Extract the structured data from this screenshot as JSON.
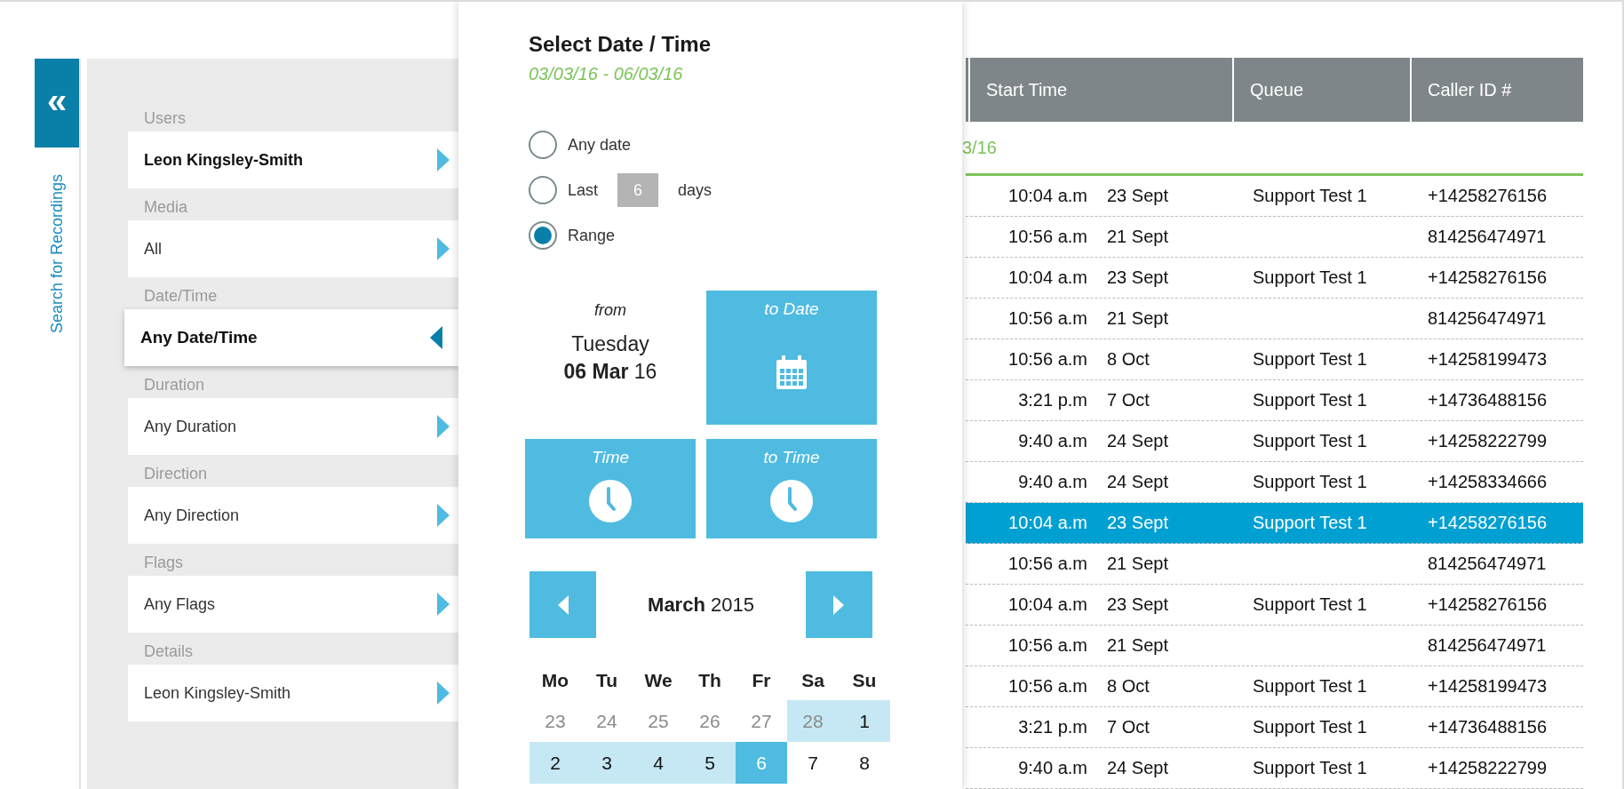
{
  "sidebar": {
    "collapse_button": "«",
    "title": "Search for Recordings",
    "filters": [
      {
        "label": "Users",
        "value": "Leon Kingsley-Smith",
        "bold": true,
        "selected": false
      },
      {
        "label": "Media",
        "value": "All",
        "bold": false,
        "selected": false
      },
      {
        "label": "Date/Time",
        "value": "Any Date/Time",
        "bold": true,
        "selected": true
      },
      {
        "label": "Duration",
        "value": "Any Duration",
        "bold": false,
        "selected": false
      },
      {
        "label": "Direction",
        "value": "Any Direction",
        "bold": false,
        "selected": false
      },
      {
        "label": "Flags",
        "value": "Any Flags",
        "bold": false,
        "selected": false
      },
      {
        "label": "Details",
        "value": "Leon Kingsley-Smith",
        "bold": false,
        "selected": false
      }
    ]
  },
  "date_picker": {
    "title": "Select Date / Time",
    "range": "03/03/16 - 06/03/16",
    "options": [
      {
        "kind": "plain",
        "label": "Any date",
        "selected": false
      },
      {
        "kind": "days",
        "label": "Last",
        "placeholder": "6",
        "suffix": "days",
        "selected": false
      },
      {
        "kind": "plain",
        "label": "Range",
        "selected": true
      }
    ],
    "from": {
      "label": "from",
      "weekday": "Tuesday",
      "date": "**06 Mar** 16"
    },
    "to_date": {
      "label": "to Date"
    },
    "time": {
      "label": "Time"
    },
    "to_time": {
      "label": "to Time"
    },
    "calendar": {
      "month": "**March** 2015",
      "weekdays": [
        "Mo",
        "Tu",
        "We",
        "Th",
        "Fr",
        "Sa",
        "Su"
      ],
      "weeks": [
        [
          {
            "day": "23",
            "muted": true,
            "in_range": false,
            "selected": false
          },
          {
            "day": "24",
            "muted": true,
            "in_range": false,
            "selected": false
          },
          {
            "day": "25",
            "muted": true,
            "in_range": false,
            "selected": false
          },
          {
            "day": "26",
            "muted": true,
            "in_range": false,
            "selected": false
          },
          {
            "day": "27",
            "muted": true,
            "in_range": false,
            "selected": false
          },
          {
            "day": "28",
            "muted": true,
            "in_range": true,
            "selected": false
          },
          {
            "day": "1",
            "muted": false,
            "in_range": true,
            "selected": false
          }
        ],
        [
          {
            "day": "2",
            "muted": false,
            "in_range": true,
            "selected": false
          },
          {
            "day": "3",
            "muted": false,
            "in_range": true,
            "selected": false
          },
          {
            "day": "4",
            "muted": false,
            "in_range": true,
            "selected": false
          },
          {
            "day": "5",
            "muted": false,
            "in_range": true,
            "selected": false
          },
          {
            "day": "6",
            "muted": false,
            "in_range": false,
            "selected": true
          },
          {
            "day": "7",
            "muted": false,
            "in_range": false,
            "selected": false
          },
          {
            "day": "8",
            "muted": false,
            "in_range": false,
            "selected": false
          }
        ]
      ]
    }
  },
  "table": {
    "columns": [
      "Start Time",
      "Queue",
      "Caller ID #"
    ],
    "group_label": "3/16",
    "rows": [
      {
        "time": "10:04 a.m",
        "date": "23 Sept",
        "queue": "Support Test 1",
        "caller_id": "+14258276156",
        "selected": false
      },
      {
        "time": "10:56 a.m",
        "date": "21 Sept",
        "caller_id": "814256474971",
        "selected": false
      },
      {
        "time": "10:04 a.m",
        "date": "23 Sept",
        "queue": "Support Test 1",
        "caller_id": "+14258276156",
        "selected": false
      },
      {
        "time": "10:56 a.m",
        "date": "21 Sept",
        "caller_id": "814256474971",
        "selected": false
      },
      {
        "time": "10:56 a.m",
        "date": "8 Oct",
        "queue": "Support Test 1",
        "caller_id": "+14258199473",
        "selected": false
      },
      {
        "time": "3:21 p.m",
        "date": "7 Oct",
        "queue": "Support Test 1",
        "caller_id": "+14736488156",
        "selected": false
      },
      {
        "time": "9:40 a.m",
        "date": "24 Sept",
        "queue": "Support Test 1",
        "caller_id": "+14258222799",
        "selected": false
      },
      {
        "time": "9:40 a.m",
        "date": "24 Sept",
        "queue": "Support Test 1",
        "caller_id": "+14258334666",
        "selected": false
      },
      {
        "time": "10:04 a.m",
        "date": "23 Sept",
        "queue": "Support Test 1",
        "caller_id": "+14258276156",
        "selected": true
      },
      {
        "time": "10:56 a.m",
        "date": "21 Sept",
        "caller_id": "814256474971",
        "selected": false
      },
      {
        "time": "10:04 a.m",
        "date": "23 Sept",
        "queue": "Support Test 1",
        "caller_id": "+14258276156",
        "selected": false
      },
      {
        "time": "10:56 a.m",
        "date": "21 Sept",
        "caller_id": "814256474971",
        "selected": false
      },
      {
        "time": "10:56 a.m",
        "date": "8 Oct",
        "queue": "Support Test 1",
        "caller_id": "+14258199473",
        "selected": false
      },
      {
        "time": "3:21 p.m",
        "date": "7 Oct",
        "queue": "Support Test 1",
        "caller_id": "+14736488156",
        "selected": false
      },
      {
        "time": "9:40 a.m",
        "date": "24 Sept",
        "queue": "Support Test 1",
        "caller_id": "+14258222799",
        "selected": false
      }
    ]
  }
}
